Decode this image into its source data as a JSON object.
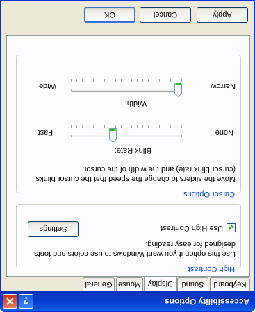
{
  "window": {
    "title": "Accessibility Options"
  },
  "tabs": [
    {
      "label": "Keyboard"
    },
    {
      "label": "Sound"
    },
    {
      "label": "Display"
    },
    {
      "label": "Mouse"
    },
    {
      "label": "General"
    }
  ],
  "active_tab": "Display",
  "high_contrast": {
    "legend": "High Contrast",
    "description_line1": "Use this option if you want Windows to use colors and fonts",
    "description_line2": "designed for easy reading.",
    "checkbox_label": "Use High Contrast",
    "checked": true,
    "settings_label": "Settings"
  },
  "cursor_options": {
    "legend": "Cursor Options",
    "description_line1": "Move the sliders to change the speed that the cursor blinks",
    "description_line2": "(cursor blink rate) and the width of the cursor.",
    "blink_rate": {
      "caption": "Blink Rate:",
      "min_label": "None",
      "max_label": "Fast",
      "value_fraction": 0.63
    },
    "width": {
      "caption": "Width:",
      "min_label": "Narrow",
      "max_label": "Wide",
      "value_fraction": 0.0
    }
  },
  "buttons": {
    "ok": "OK",
    "cancel": "Cancel",
    "apply": "Apply"
  },
  "colors": {
    "title_bar": "#0a46d8",
    "group_legend": "#0046d5",
    "tab_highlight": "#ffc83c"
  }
}
